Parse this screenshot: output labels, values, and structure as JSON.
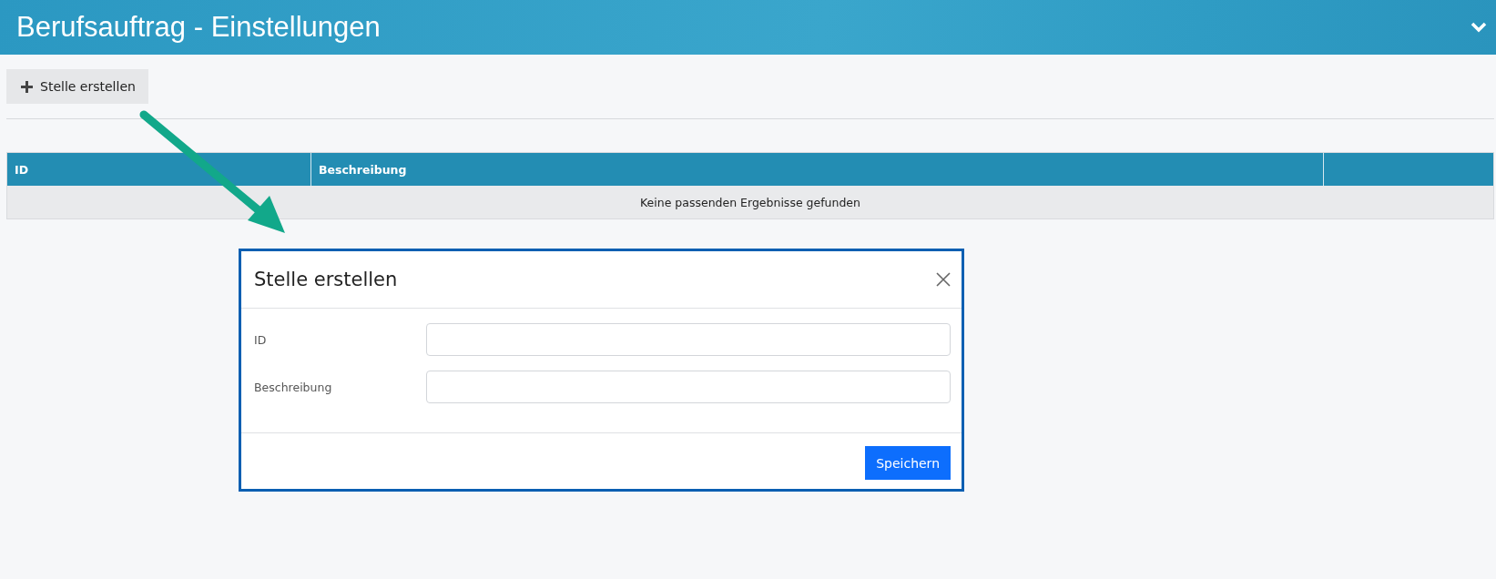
{
  "header": {
    "title": "Berufsauftrag - Einstellungen"
  },
  "toolbar": {
    "create_button": "Stelle erstellen"
  },
  "table": {
    "columns": [
      "ID",
      "Beschreibung"
    ],
    "empty_message": "Keine passenden Ergebnisse gefunden"
  },
  "dialog": {
    "title": "Stelle erstellen",
    "fields": [
      {
        "label": "ID"
      },
      {
        "label": "Beschreibung"
      }
    ],
    "save_button": "Speichern"
  }
}
